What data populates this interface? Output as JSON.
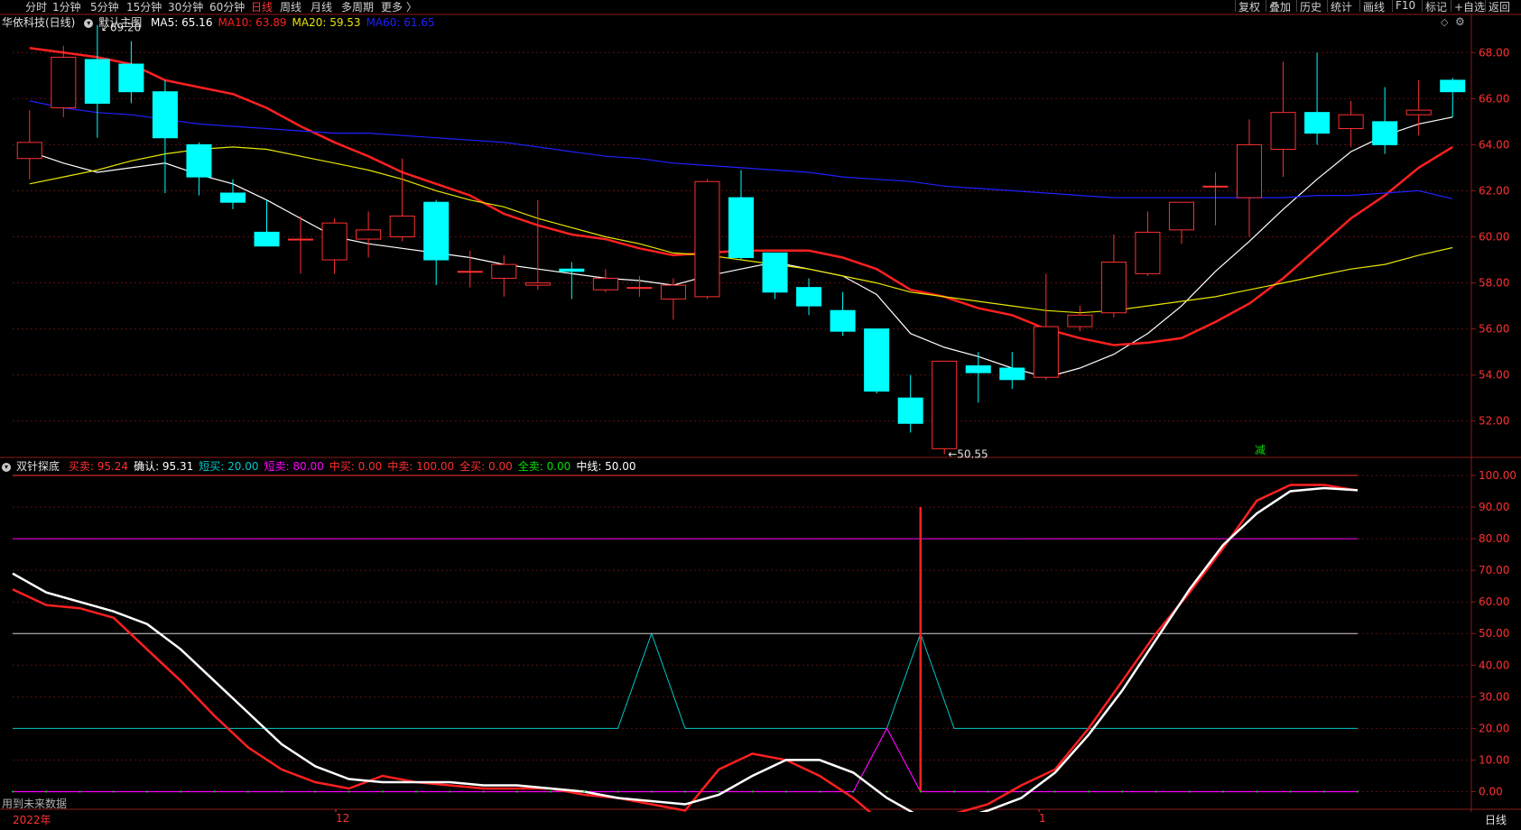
{
  "toolbar": {
    "periods": [
      "分时",
      "1分钟",
      "5分钟",
      "15分钟",
      "30分钟",
      "60分钟",
      "日线",
      "周线",
      "月线",
      "多周期",
      "更多"
    ],
    "active_period": "日线",
    "more_arrow": "〉",
    "right_buttons": [
      "复权",
      "叠加",
      "历史",
      "统计",
      "画线",
      "F10",
      "标记",
      "+自选",
      "返回"
    ]
  },
  "main_chart": {
    "title": "华依科技(日线)",
    "indicator_name": "默认主图",
    "ma": [
      {
        "label": "MA5: 65.16",
        "color": "#ffffff"
      },
      {
        "label": "MA10: 63.89",
        "color": "#ff2020"
      },
      {
        "label": "MA20: 59.53",
        "color": "#e6e600"
      },
      {
        "label": "MA60: 61.65",
        "color": "#2020ff"
      }
    ],
    "high_label": "69.20",
    "low_label": "50.55",
    "signal_label": "减",
    "y_ticks": [
      "68.00",
      "66.00",
      "64.00",
      "62.00",
      "60.00",
      "58.00",
      "56.00",
      "54.00",
      "52.00"
    ]
  },
  "indicator": {
    "name": "双针探底",
    "values": [
      {
        "label": "买卖: 95.24",
        "color": "#ff3030"
      },
      {
        "label": "确认: 95.31",
        "color": "#ffffff"
      },
      {
        "label": "短买: 20.00",
        "color": "#00c8c8"
      },
      {
        "label": "短卖: 80.00",
        "color": "#ff00ff"
      },
      {
        "label": "中买: 0.00",
        "color": "#ff3030"
      },
      {
        "label": "中卖: 100.00",
        "color": "#ff3030"
      },
      {
        "label": "全买: 0.00",
        "color": "#ff3030"
      },
      {
        "label": "全卖: 0.00",
        "color": "#00e000"
      },
      {
        "label": "中线: 50.00",
        "color": "#ffffff"
      }
    ],
    "y_ticks": [
      "100.00",
      "90.00",
      "80.00",
      "70.00",
      "60.00",
      "50.00",
      "40.00",
      "30.00",
      "20.00",
      "10.00",
      "0.00"
    ],
    "note": "用到未来数据"
  },
  "time_axis": {
    "year_label": "2022年",
    "month_labels": [
      "12",
      "1"
    ],
    "period_label": "日线"
  },
  "chart_data": [
    {
      "type": "candlestick",
      "title": "华依科技(日线)",
      "ylim": [
        50.5,
        69.5
      ],
      "candles": [
        {
          "o": 63.4,
          "c": 64.1,
          "h": 65.5,
          "l": 62.5
        },
        {
          "o": 65.6,
          "c": 67.8,
          "h": 68.3,
          "l": 65.2
        },
        {
          "o": 67.7,
          "c": 65.8,
          "h": 69.2,
          "l": 64.3
        },
        {
          "o": 67.5,
          "c": 66.3,
          "h": 68.5,
          "l": 65.8
        },
        {
          "o": 66.3,
          "c": 64.3,
          "h": 66.8,
          "l": 61.9
        },
        {
          "o": 64.0,
          "c": 62.6,
          "h": 64.1,
          "l": 61.8
        },
        {
          "o": 61.9,
          "c": 61.5,
          "h": 62.5,
          "l": 61.2
        },
        {
          "o": 60.2,
          "c": 59.6,
          "h": 61.6,
          "l": 59.6
        },
        {
          "o": 59.9,
          "c": 59.9,
          "h": 60.9,
          "l": 58.4
        },
        {
          "o": 59.0,
          "c": 60.6,
          "h": 60.8,
          "l": 58.4
        },
        {
          "o": 59.9,
          "c": 60.3,
          "h": 61.1,
          "l": 59.1
        },
        {
          "o": 60.0,
          "c": 60.9,
          "h": 63.4,
          "l": 59.8
        },
        {
          "o": 61.5,
          "c": 59.0,
          "h": 61.6,
          "l": 57.9
        },
        {
          "o": 58.5,
          "c": 58.5,
          "h": 59.4,
          "l": 57.8
        },
        {
          "o": 58.2,
          "c": 58.8,
          "h": 59.2,
          "l": 57.4
        },
        {
          "o": 57.9,
          "c": 58.0,
          "h": 61.6,
          "l": 57.7
        },
        {
          "o": 58.6,
          "c": 58.5,
          "h": 58.9,
          "l": 57.3
        },
        {
          "o": 57.7,
          "c": 58.2,
          "h": 58.6,
          "l": 57.6
        },
        {
          "o": 57.8,
          "c": 57.8,
          "h": 58.3,
          "l": 57.4
        },
        {
          "o": 57.3,
          "c": 57.9,
          "h": 58.2,
          "l": 56.4
        },
        {
          "o": 57.4,
          "c": 62.4,
          "h": 62.5,
          "l": 57.3
        },
        {
          "o": 61.7,
          "c": 59.1,
          "h": 62.9,
          "l": 59.0
        },
        {
          "o": 59.3,
          "c": 57.6,
          "h": 59.3,
          "l": 57.3
        },
        {
          "o": 57.8,
          "c": 57.0,
          "h": 58.2,
          "l": 56.6
        },
        {
          "o": 56.8,
          "c": 55.9,
          "h": 57.6,
          "l": 55.7
        },
        {
          "o": 56.0,
          "c": 53.3,
          "h": 56.0,
          "l": 53.2
        },
        {
          "o": 53.0,
          "c": 51.9,
          "h": 54.0,
          "l": 51.5
        },
        {
          "o": 50.8,
          "c": 54.6,
          "h": 54.6,
          "l": 50.55
        },
        {
          "o": 54.4,
          "c": 54.1,
          "h": 55.0,
          "l": 52.8
        },
        {
          "o": 54.3,
          "c": 53.8,
          "h": 55.0,
          "l": 53.4
        },
        {
          "o": 53.9,
          "c": 56.1,
          "h": 58.4,
          "l": 53.8
        },
        {
          "o": 56.1,
          "c": 56.6,
          "h": 57.0,
          "l": 55.9
        },
        {
          "o": 56.7,
          "c": 58.9,
          "h": 60.1,
          "l": 56.5
        },
        {
          "o": 58.4,
          "c": 60.2,
          "h": 61.1,
          "l": 58.3
        },
        {
          "o": 60.3,
          "c": 61.5,
          "h": 61.5,
          "l": 59.7
        },
        {
          "o": 62.2,
          "c": 62.2,
          "h": 62.8,
          "l": 60.5
        },
        {
          "o": 61.7,
          "c": 64.0,
          "h": 65.1,
          "l": 60.0
        },
        {
          "o": 63.8,
          "c": 65.4,
          "h": 67.6,
          "l": 62.6
        },
        {
          "o": 65.4,
          "c": 64.5,
          "h": 68.0,
          "l": 64.0
        },
        {
          "o": 64.7,
          "c": 65.3,
          "h": 65.9,
          "l": 63.9
        },
        {
          "o": 65.0,
          "c": 64.0,
          "h": 66.5,
          "l": 63.6
        },
        {
          "o": 65.3,
          "c": 65.5,
          "h": 66.8,
          "l": 64.4
        },
        {
          "o": 66.8,
          "c": 66.3,
          "h": 66.9,
          "l": 65.2
        }
      ],
      "series": [
        {
          "name": "MA5",
          "values": [
            63.7,
            63.2,
            62.8,
            63.0,
            63.2,
            62.7,
            62.3,
            61.6,
            60.8,
            60.0,
            59.7,
            59.5,
            59.3,
            59.1,
            58.8,
            58.6,
            58.4,
            58.2,
            58.1,
            57.9,
            58.3,
            58.6,
            58.9,
            58.6,
            58.3,
            57.5,
            55.8,
            55.2,
            54.8,
            54.3,
            53.9,
            54.3,
            54.9,
            55.8,
            57.0,
            58.5,
            59.8,
            61.2,
            62.5,
            63.7,
            64.4,
            64.9,
            65.2
          ]
        },
        {
          "name": "MA10",
          "values": [
            68.2,
            68.0,
            67.8,
            67.5,
            66.8,
            66.5,
            66.2,
            65.6,
            64.8,
            64.1,
            63.5,
            62.8,
            62.3,
            61.8,
            61.0,
            60.5,
            60.1,
            59.9,
            59.5,
            59.2,
            59.3,
            59.4,
            59.4,
            59.4,
            59.1,
            58.6,
            57.7,
            57.4,
            56.9,
            56.6,
            56.0,
            55.6,
            55.3,
            55.4,
            55.6,
            56.3,
            57.1,
            58.2,
            59.5,
            60.8,
            61.8,
            63.0,
            63.9
          ]
        },
        {
          "name": "MA20",
          "values": [
            62.3,
            62.6,
            62.9,
            63.3,
            63.6,
            63.8,
            63.9,
            63.8,
            63.5,
            63.2,
            62.9,
            62.5,
            62.0,
            61.6,
            61.3,
            60.8,
            60.4,
            60.0,
            59.7,
            59.3,
            59.2,
            59.0,
            58.8,
            58.6,
            58.3,
            58.0,
            57.6,
            57.4,
            57.2,
            57.0,
            56.8,
            56.7,
            56.8,
            57.0,
            57.2,
            57.4,
            57.7,
            58.0,
            58.3,
            58.6,
            58.8,
            59.2,
            59.53
          ]
        },
        {
          "name": "MA60",
          "values": [
            65.9,
            65.6,
            65.4,
            65.3,
            65.1,
            64.9,
            64.8,
            64.7,
            64.6,
            64.5,
            64.5,
            64.4,
            64.3,
            64.2,
            64.1,
            63.9,
            63.7,
            63.5,
            63.4,
            63.2,
            63.1,
            63.0,
            62.9,
            62.8,
            62.6,
            62.5,
            62.4,
            62.2,
            62.1,
            62.0,
            61.9,
            61.8,
            61.7,
            61.7,
            61.7,
            61.7,
            61.7,
            61.7,
            61.8,
            61.8,
            61.9,
            62.0,
            61.65
          ]
        }
      ]
    },
    {
      "type": "line",
      "title": "双针探底",
      "ylim": [
        -5,
        102
      ],
      "series": [
        {
          "name": "买卖",
          "values": [
            64,
            59,
            58,
            55,
            45,
            35,
            24,
            14,
            7,
            3,
            1,
            5,
            3,
            2,
            1,
            1,
            1,
            -1,
            -2,
            -4,
            -6,
            7,
            12,
            10,
            5,
            -2,
            -11,
            -10,
            -7,
            -4,
            2,
            7,
            20,
            35,
            50,
            63,
            77,
            92,
            97,
            97,
            95.24
          ]
        },
        {
          "name": "确认",
          "values": [
            69,
            63,
            60,
            57,
            53,
            45,
            35,
            25,
            15,
            8,
            4,
            3,
            3,
            3,
            2,
            2,
            1,
            0,
            -2,
            -3,
            -4,
            -1,
            5,
            10,
            10,
            6,
            -2,
            -8,
            -9,
            -6,
            -2,
            6,
            18,
            32,
            48,
            64,
            78,
            88,
            95,
            96,
            95.31
          ]
        },
        {
          "name": "短买",
          "values": [
            20,
            20,
            20,
            20,
            20,
            20,
            20,
            20,
            20,
            20,
            20,
            20,
            20,
            20,
            20,
            20,
            20,
            20,
            20,
            50,
            20,
            20,
            20,
            20,
            20,
            20,
            20,
            50,
            20,
            20,
            20,
            20,
            20,
            20,
            20,
            20,
            20,
            20,
            20,
            20,
            20
          ]
        },
        {
          "name": "短卖",
          "values": [
            0,
            0,
            0,
            0,
            0,
            0,
            0,
            0,
            0,
            0,
            0,
            0,
            0,
            0,
            0,
            0,
            0,
            0,
            0,
            0,
            0,
            0,
            0,
            0,
            0,
            0,
            20,
            0,
            0,
            0,
            0,
            0,
            0,
            0,
            0,
            0,
            0,
            0,
            0,
            0,
            0
          ]
        },
        {
          "name": "中卖",
          "values": [
            100
          ]
        },
        {
          "name": "中线",
          "values": [
            50
          ]
        }
      ],
      "spike_value": 90
    }
  ]
}
